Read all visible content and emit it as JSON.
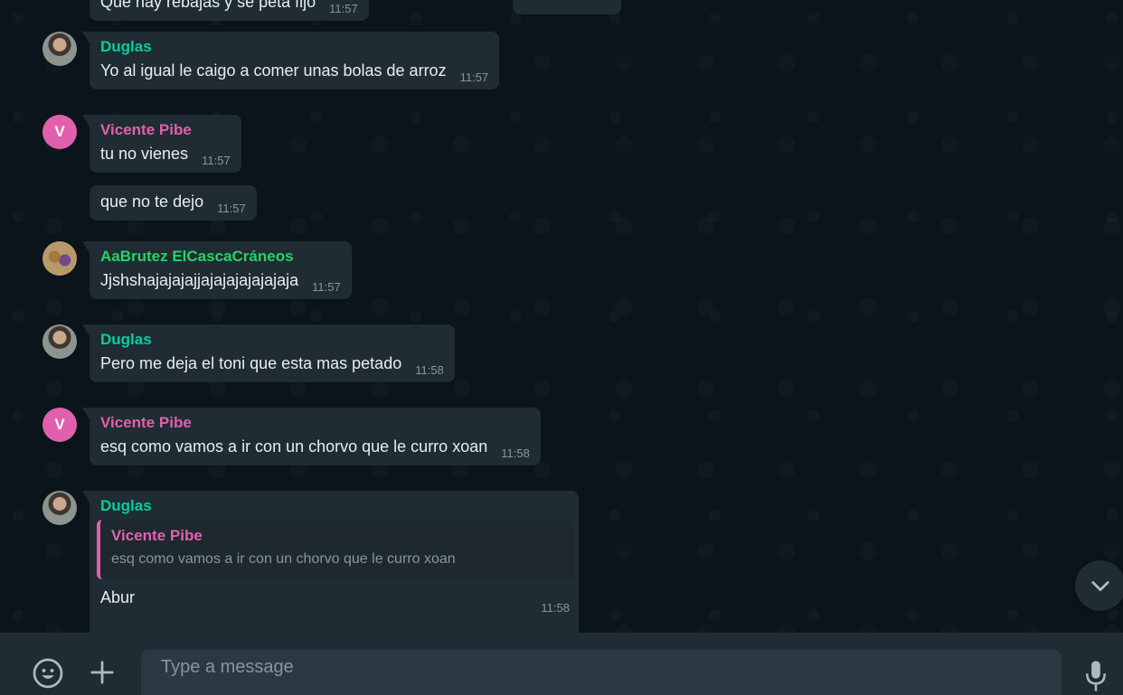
{
  "messages": [
    {
      "text": "Que hay rebajas y se peta fijo",
      "time": "11:57"
    },
    {
      "sender": "Duglas",
      "text": "Yo al igual le caigo a comer unas bolas de arroz",
      "time": "11:57"
    },
    {
      "sender": "Vicente Pibe",
      "avatar_letter": "V",
      "text": "tu no vienes",
      "time": "11:57"
    },
    {
      "text": "que no te dejo",
      "time": "11:57"
    },
    {
      "sender": "AaBrutez ElCascaCráneos",
      "text": "Jjshshajajajajjajajajajajajaja",
      "time": "11:57"
    },
    {
      "sender": "Duglas",
      "text": "Pero me deja el toni que esta mas petado",
      "time": "11:58"
    },
    {
      "sender": "Vicente Pibe",
      "avatar_letter": "V",
      "text": "esq como vamos a ir con un chorvo que le curro xoan",
      "time": "11:58"
    },
    {
      "sender": "Duglas",
      "quote_sender": "Vicente Pibe",
      "quote_text": "esq como vamos a ir con un chorvo que le curro xoan",
      "text": "Abur",
      "time": "11:58"
    }
  ],
  "footer": {
    "placeholder": "Type a message",
    "emoji_icon": "emoji-icon",
    "attach_icon": "plus-icon",
    "mic_icon": "microphone-icon"
  },
  "colors": {
    "background": "#0b141a",
    "bubble": "#202c33",
    "duglas": "#06cf9c",
    "vicente": "#e160ad",
    "aabrutez": "#25d366",
    "timestamp": "#8696a0"
  }
}
